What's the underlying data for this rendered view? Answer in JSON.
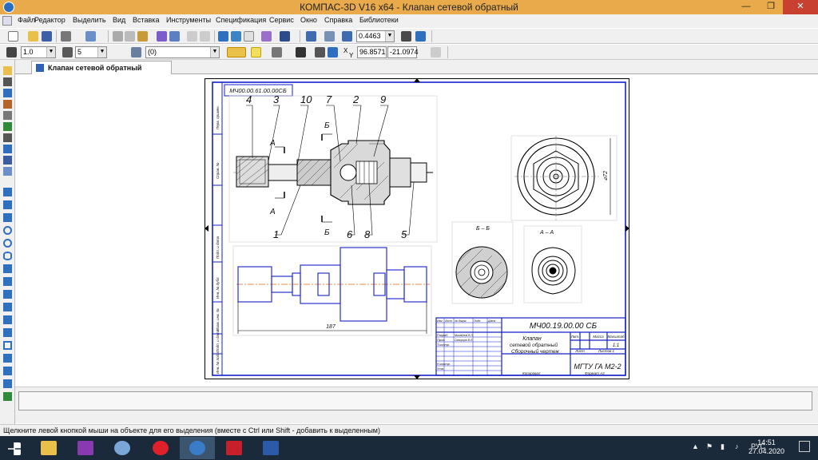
{
  "window": {
    "title": "КОМПАС-3D V16  x64 - Клапан сетевой обратный",
    "minimize": "—",
    "maximize": "❐",
    "close": "✕"
  },
  "menu": {
    "items": [
      "Файл",
      "Редактор",
      "Выделить",
      "Вид",
      "Вставка",
      "Инструменты",
      "Спецификация",
      "Сервис",
      "Окно",
      "Справка",
      "Библиотеки"
    ]
  },
  "toolbar1": {
    "zoom_value": "0.4463"
  },
  "toolbar2": {
    "line_scale": "1.0",
    "layer_style": "5",
    "layer_name": "(0)",
    "x_coord": "96.8571",
    "y_coord": "-21.0974",
    "x_label": "X",
    "y_label": "Y"
  },
  "document_tab": {
    "label": "Клапан сетевой обратный"
  },
  "drawing": {
    "stamp_top_inverted": "МЧ00.00.61.00.00СБ",
    "callouts_top": [
      "4",
      "3",
      "10",
      "7",
      "2",
      "9"
    ],
    "callouts_bottom": [
      "1",
      "6",
      "8",
      "5"
    ],
    "section_A": "А",
    "section_B": "Б",
    "section_label_BB": "Б – Б",
    "section_label_AA": "А – А",
    "dimension_length": "187",
    "dimension_diameter": "⌀72",
    "title_block": {
      "designation": "МЧ00.19.00.00 СБ",
      "name_line1": "Клапан",
      "name_line2": "сетевой обратный",
      "name_line3": "Сборочный чертеж",
      "organization": "МГТУ ГА М2-2",
      "col_lit": "Лит.",
      "col_mass": "Масса",
      "col_scale": "Масштаб",
      "scale_value": "1:1",
      "sheet_label": "Лист",
      "sheets_label": "Листов 1",
      "copied": "Копировал",
      "format": "Формат  А3",
      "role_razrab": "Разраб.",
      "role_prov": "Пров.",
      "role_tkontr": "Т.контр.",
      "role_nkontr": "Н.контр.",
      "role_utv": "Утв.",
      "name_razrab": "Михайлов В.Л.",
      "name_prov": "Скворцов В.Л.",
      "hdr_izm": "Изм",
      "hdr_list": "Лист",
      "hdr_ndokum": "№ докум.",
      "hdr_podp": "Подп.",
      "hdr_data": "Дата"
    },
    "left_strip_labels": [
      "Перв. примен.",
      "Справ. №",
      "Подп. и дата",
      "Инв. № дубл.",
      "Взам. инв. №",
      "Подп. и дата",
      "Инв. № подл."
    ]
  },
  "status": {
    "hint": "Щелкните левой кнопкой мыши на объекте для его выделения (вместе с Ctrl или Shift - добавить к выделенным)"
  },
  "taskbar": {
    "lang": "РУС",
    "time": "14:51",
    "date": "27.04.2020"
  }
}
